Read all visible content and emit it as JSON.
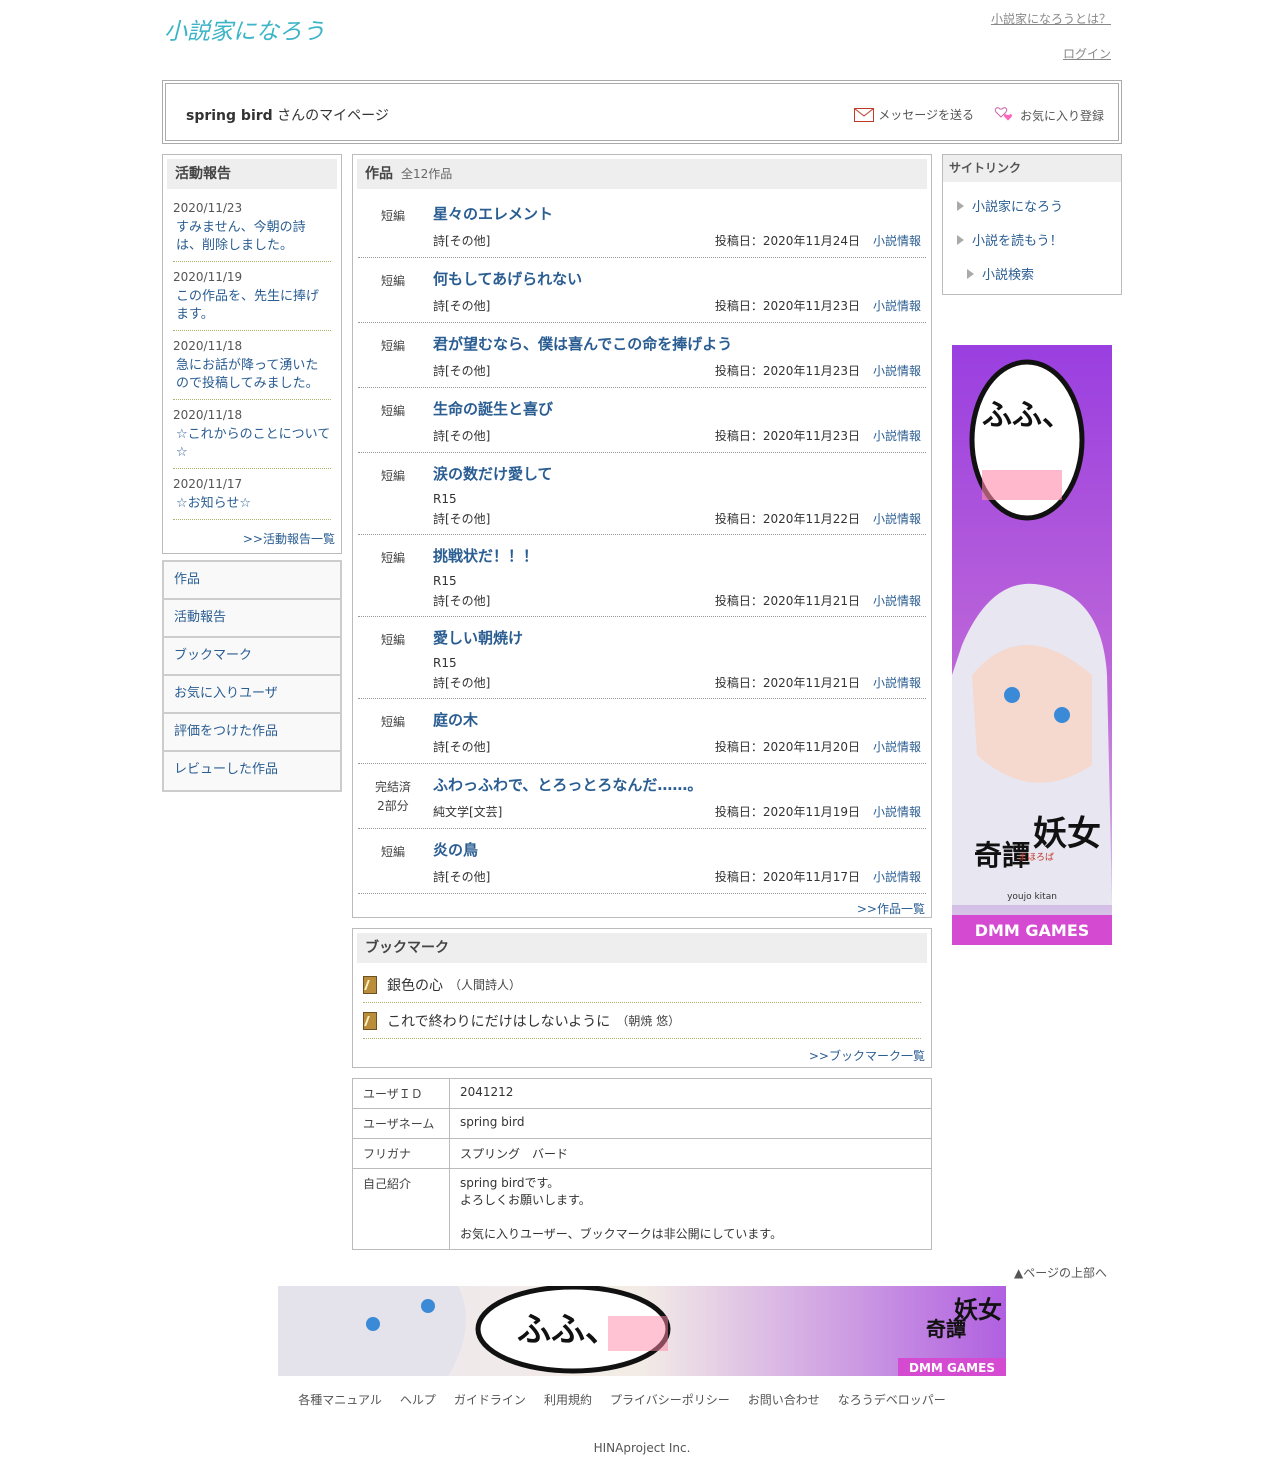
{
  "header": {
    "logo_text": "小説家になろう",
    "about_link": "小説家になろうとは？",
    "login_link": "ログイン"
  },
  "userbox": {
    "name": "spring bird",
    "suffix": "さんのマイページ",
    "send_message": "メッセージを送る",
    "favorite_register": "お気に入り登録"
  },
  "activity": {
    "title": "活動報告",
    "items": [
      {
        "date": "2020/11/23",
        "title": "すみません、今朝の詩は、削除しました。"
      },
      {
        "date": "2020/11/19",
        "title": "この作品を、先生に捧げます。"
      },
      {
        "date": "2020/11/18",
        "title": "急にお話が降って湧いたので投稿してみました。"
      },
      {
        "date": "2020/11/18",
        "title": "☆これからのことについて☆"
      },
      {
        "date": "2020/11/17",
        "title": "☆お知らせ☆"
      }
    ],
    "more": ">>活動報告一覧"
  },
  "menu": [
    "作品",
    "活動報告",
    "ブックマーク",
    "お気に入りユーザ",
    "評価をつけた作品",
    "レビューした作品"
  ],
  "works": {
    "title": "作品",
    "count": "全12作品",
    "items": [
      {
        "kind": "短編",
        "title": "星々のエレメント",
        "r15": "",
        "genre": "詩[その他]",
        "date": "投稿日：2020年11月24日",
        "info": "小説情報"
      },
      {
        "kind": "短編",
        "title": "何もしてあげられない",
        "r15": "",
        "genre": "詩[その他]",
        "date": "投稿日：2020年11月23日",
        "info": "小説情報"
      },
      {
        "kind": "短編",
        "title": "君が望むなら、僕は喜んでこの命を捧げよう",
        "r15": "",
        "genre": "詩[その他]",
        "date": "投稿日：2020年11月23日",
        "info": "小説情報"
      },
      {
        "kind": "短編",
        "title": "生命の誕生と喜び",
        "r15": "",
        "genre": "詩[その他]",
        "date": "投稿日：2020年11月23日",
        "info": "小説情報"
      },
      {
        "kind": "短編",
        "title": "涙の数だけ愛して",
        "r15": "R15",
        "genre": "詩[その他]",
        "date": "投稿日：2020年11月22日",
        "info": "小説情報"
      },
      {
        "kind": "短編",
        "title": "挑戦状だ！！！",
        "r15": "R15",
        "genre": "詩[その他]",
        "date": "投稿日：2020年11月21日",
        "info": "小説情報"
      },
      {
        "kind": "短編",
        "title": "愛しい朝焼け",
        "r15": "R15",
        "genre": "詩[その他]",
        "date": "投稿日：2020年11月21日",
        "info": "小説情報"
      },
      {
        "kind": "短編",
        "title": "庭の木",
        "r15": "",
        "genre": "詩[その他]",
        "date": "投稿日：2020年11月20日",
        "info": "小説情報"
      },
      {
        "kind": "完結済\n2部分",
        "title": "ふわっふわで、とろっとろなんだ……。",
        "r15": "",
        "genre": "純文学[文芸]",
        "date": "投稿日：2020年11月19日",
        "info": "小説情報"
      },
      {
        "kind": "短編",
        "title": "炎の鳥",
        "r15": "",
        "genre": "詩[その他]",
        "date": "投稿日：2020年11月17日",
        "info": "小説情報"
      }
    ],
    "more": ">>作品一覧"
  },
  "bookmark": {
    "title": "ブックマーク",
    "items": [
      {
        "title": "銀色の心",
        "author": "（人間詩人）"
      },
      {
        "title": "これで終わりにだけはしないように",
        "author": "（朝焼 悠）"
      }
    ],
    "more": ">>ブックマーク一覧"
  },
  "profile": {
    "rows": [
      {
        "key": "ユーザＩＤ",
        "value": "2041212"
      },
      {
        "key": "ユーザネーム",
        "value": "spring bird"
      },
      {
        "key": "フリガナ",
        "value": "スプリング　バード"
      }
    ],
    "intro_key": "自己紹介",
    "intro_lines": [
      "spring birdです。",
      "よろしくお願いします。",
      "お気に入りユーザー、ブックマークは非公開にしています。"
    ]
  },
  "sitelink": {
    "title": "サイトリンク",
    "items": [
      "小説家になろう",
      "小説を読もう！",
      "小説検索"
    ]
  },
  "ads": {
    "side_bubble": "ふふ、",
    "side_title_1": "妖女",
    "side_title_2": "奇譚",
    "side_sub": "まほろば",
    "side_roman": "youjo kitan",
    "brand": "DMM GAMES",
    "bottom_bubble": "ふふ、"
  },
  "pagetop": "▲ページの上部へ",
  "footer": {
    "links": [
      "各種マニュアル",
      "ヘルプ",
      "ガイドライン",
      "利用規約",
      "プライバシーポリシー",
      "お問い合わせ",
      "なろうデベロッパー"
    ],
    "copyright": "HINAproject Inc."
  },
  "colors": {
    "link": "#2a5d92",
    "logo": "#3cb4c8",
    "ad_purple": "#9a3fe0",
    "ad_pink": "#e04ab8"
  }
}
